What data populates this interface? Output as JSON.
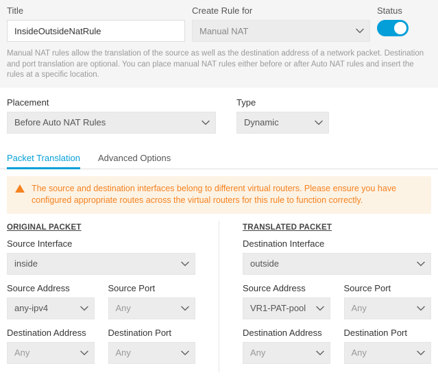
{
  "topRow": {
    "titleLabel": "Title",
    "titleValue": "InsideOutsideNatRule",
    "ruleForLabel": "Create Rule for",
    "ruleForValue": "Manual NAT",
    "statusLabel": "Status"
  },
  "helpText": "Manual NAT rules allow the translation of the source as well as the destination address of a network packet. Destination and port translation are optional. You can place manual NAT rules either before or after Auto NAT rules and insert the rules at a specific location.",
  "placement": {
    "label": "Placement",
    "value": "Before Auto NAT Rules"
  },
  "type": {
    "label": "Type",
    "value": "Dynamic"
  },
  "tabs": {
    "packetTranslation": "Packet Translation",
    "advancedOptions": "Advanced Options"
  },
  "warning": "The source and destination interfaces belong to different virtual routers. Please ensure you have configured appropriate routes across the virtual routers for this rule to function correctly.",
  "original": {
    "heading": "ORIGINAL PACKET",
    "sourceInterfaceLabel": "Source Interface",
    "sourceInterfaceValue": "inside",
    "sourceAddressLabel": "Source Address",
    "sourceAddressValue": "any-ipv4",
    "sourcePortLabel": "Source Port",
    "sourcePortValue": "Any",
    "destAddressLabel": "Destination Address",
    "destAddressValue": "Any",
    "destPortLabel": "Destination Port",
    "destPortValue": "Any"
  },
  "translated": {
    "heading": "TRANSLATED PACKET",
    "destInterfaceLabel": "Destination Interface",
    "destInterfaceValue": "outside",
    "sourceAddressLabel": "Source Address",
    "sourceAddressValue": "VR1-PAT-pool",
    "sourcePortLabel": "Source Port",
    "sourcePortValue": "Any",
    "destAddressLabel": "Destination Address",
    "destAddressValue": "Any",
    "destPortLabel": "Destination Port",
    "destPortValue": "Any"
  }
}
